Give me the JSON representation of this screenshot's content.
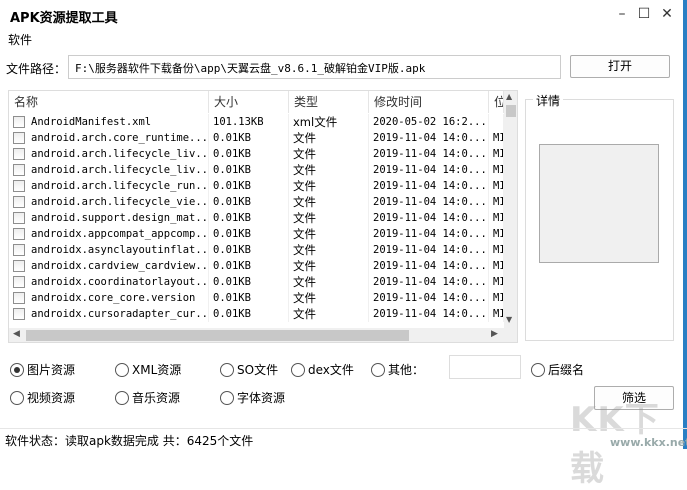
{
  "window": {
    "title": "APK资源提取工具",
    "minimize": "–",
    "maximize": "☐",
    "close": "✕"
  },
  "menu": {
    "software": "软件"
  },
  "path": {
    "label": "文件路径：",
    "value": "F:\\服务器软件下载备份\\app\\天翼云盘_v8.6.1_破解铂金VIP版.apk",
    "open_button": "打开"
  },
  "table": {
    "columns": [
      "名称",
      "大小",
      "类型",
      "修改时间",
      "位"
    ],
    "rows": [
      [
        "AndroidManifest.xml",
        "101.13KB",
        "xml文件",
        "2020-05-02 16:2...",
        ""
      ],
      [
        "android.arch.core_runtime....",
        "0.01KB",
        "文件",
        "2019-11-04 14:0...",
        "MI"
      ],
      [
        "android.arch.lifecycle_liv...",
        "0.01KB",
        "文件",
        "2019-11-04 14:0...",
        "MI"
      ],
      [
        "android.arch.lifecycle_liv...",
        "0.01KB",
        "文件",
        "2019-11-04 14:0...",
        "MI"
      ],
      [
        "android.arch.lifecycle_run...",
        "0.01KB",
        "文件",
        "2019-11-04 14:0...",
        "MI"
      ],
      [
        "android.arch.lifecycle_vie...",
        "0.01KB",
        "文件",
        "2019-11-04 14:0...",
        "MI"
      ],
      [
        "android.support.design_mat...",
        "0.01KB",
        "文件",
        "2019-11-04 14:0...",
        "MI"
      ],
      [
        "androidx.appcompat_appcomp...",
        "0.01KB",
        "文件",
        "2019-11-04 14:0...",
        "MI"
      ],
      [
        "androidx.asynclayoutinflat...",
        "0.01KB",
        "文件",
        "2019-11-04 14:0...",
        "MI"
      ],
      [
        "androidx.cardview_cardview...",
        "0.01KB",
        "文件",
        "2019-11-04 14:0...",
        "MI"
      ],
      [
        "androidx.coordinatorlayout...",
        "0.01KB",
        "文件",
        "2019-11-04 14:0...",
        "MI"
      ],
      [
        "androidx.core_core.version",
        "0.01KB",
        "文件",
        "2019-11-04 14:0...",
        "MI"
      ],
      [
        "androidx.cursoradapter_cur...",
        "0.01KB",
        "文件",
        "2019-11-04 14:0...",
        "MI"
      ]
    ]
  },
  "details": {
    "label": "详情"
  },
  "filters": {
    "options": [
      "图片资源",
      "XML资源",
      "SO文件",
      "dex文件",
      "其他：",
      "后缀名",
      "视频资源",
      "音乐资源",
      "字体资源"
    ],
    "selected": "图片资源",
    "filter_button": "筛选"
  },
  "status": {
    "text": "软件状态：读取apk数据完成 共：6425个文件"
  },
  "watermark": {
    "logo": "KK下载",
    "url": "www.kkx.net"
  }
}
